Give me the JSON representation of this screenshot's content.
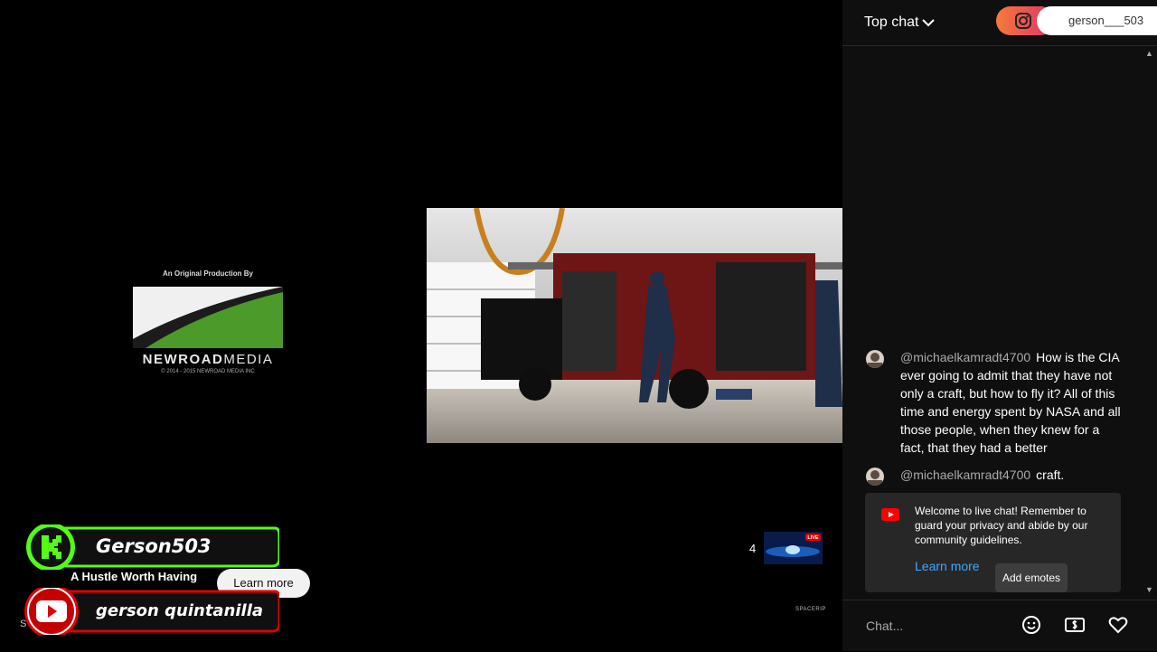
{
  "video": {
    "production_credit": "An Original Production By",
    "logo_name_bold": "NEWROAD",
    "logo_name_light": "MEDIA",
    "logo_copyright": "© 2014 - 2015 NEWROAD MEDIA INC",
    "overlay_kick_name": "Gerson503",
    "overlay_youtube_name": "gerson quintanilla",
    "sponsor_text": "A Hustle Worth Having",
    "sponsor_button": "Learn more",
    "left_small_text": "S",
    "queue_count": "4",
    "watermark": "SPACERIP",
    "live_badge": "LIVE"
  },
  "chat": {
    "header_title": "Top chat",
    "instagram_handle": "gerson___503",
    "messages": [
      {
        "author": "@michaelkamradt4700",
        "text": "How is the CIA ever going to admit that they have not only a craft, but how to fly it? All of this time and energy spent by NASA and all those people, when they knew for a fact, that they had a better"
      },
      {
        "author": "@michaelkamradt4700",
        "text": "craft."
      }
    ],
    "welcome_text": "Welcome to live chat! Remember to guard your privacy and abide by our community guidelines.",
    "welcome_learn_more": "Learn more",
    "add_emotes": "Add emotes",
    "input_placeholder": "Chat...",
    "colors": {
      "link": "#3ea6ff",
      "kick_green": "#53fc18",
      "youtube_red": "#ff0000"
    }
  }
}
